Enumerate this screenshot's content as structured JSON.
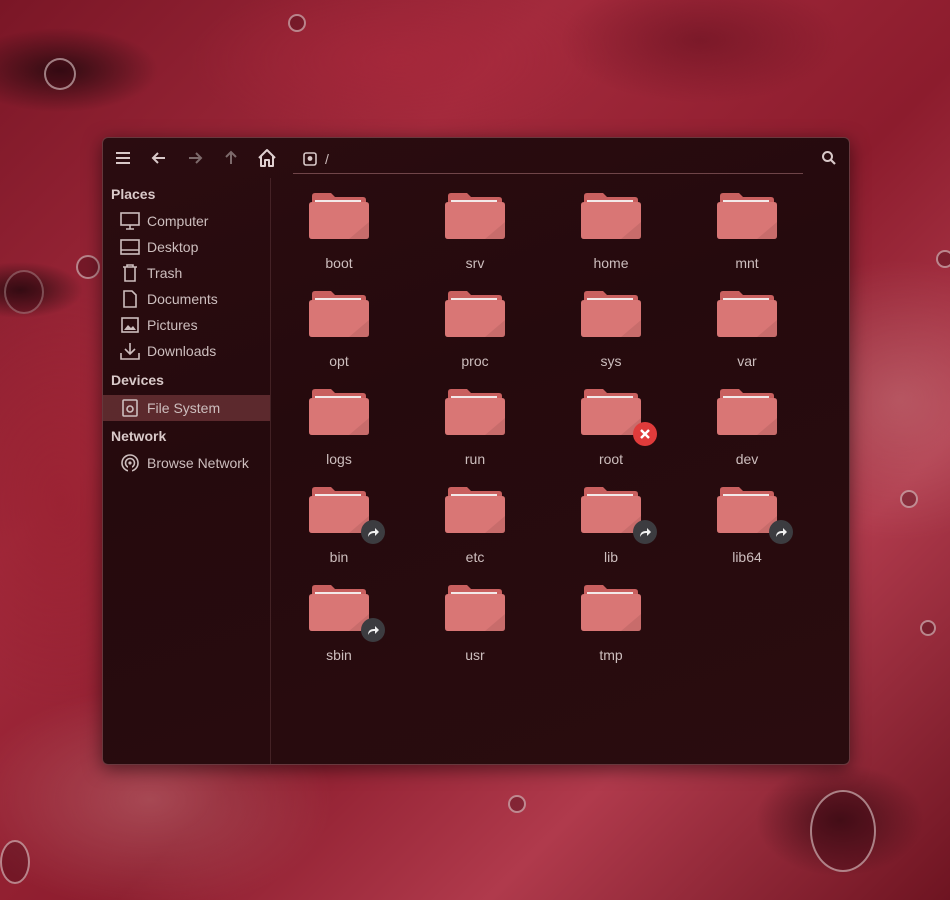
{
  "window": {
    "path": "/",
    "toolbar": {
      "menu_icon": "hamburger-menu-icon",
      "back_icon": "arrow-left-icon",
      "forward_icon": "arrow-right-icon",
      "up_icon": "arrow-up-icon",
      "home_icon": "home-icon",
      "search_icon": "search-icon"
    }
  },
  "sidebar": {
    "places_title": "Places",
    "places": [
      {
        "label": "Computer",
        "icon": "computer-icon"
      },
      {
        "label": "Desktop",
        "icon": "desktop-icon"
      },
      {
        "label": "Trash",
        "icon": "trash-icon"
      },
      {
        "label": "Documents",
        "icon": "document-icon"
      },
      {
        "label": "Pictures",
        "icon": "picture-icon"
      },
      {
        "label": "Downloads",
        "icon": "download-icon"
      }
    ],
    "devices_title": "Devices",
    "devices": [
      {
        "label": "File System",
        "icon": "drive-icon",
        "active": true
      }
    ],
    "network_title": "Network",
    "network": [
      {
        "label": "Browse Network",
        "icon": "network-icon"
      }
    ]
  },
  "folders": [
    {
      "name": "boot",
      "emblem": null
    },
    {
      "name": "srv",
      "emblem": null
    },
    {
      "name": "home",
      "emblem": null
    },
    {
      "name": "mnt",
      "emblem": null
    },
    {
      "name": "opt",
      "emblem": null
    },
    {
      "name": "proc",
      "emblem": null
    },
    {
      "name": "sys",
      "emblem": null
    },
    {
      "name": "var",
      "emblem": null
    },
    {
      "name": "logs",
      "emblem": null
    },
    {
      "name": "run",
      "emblem": null
    },
    {
      "name": "root",
      "emblem": "no-access"
    },
    {
      "name": "dev",
      "emblem": null
    },
    {
      "name": "bin",
      "emblem": "symlink"
    },
    {
      "name": "etc",
      "emblem": null
    },
    {
      "name": "lib",
      "emblem": "symlink"
    },
    {
      "name": "lib64",
      "emblem": "symlink"
    },
    {
      "name": "sbin",
      "emblem": "symlink"
    },
    {
      "name": "usr",
      "emblem": null
    },
    {
      "name": "tmp",
      "emblem": null
    }
  ],
  "colors": {
    "folder": "#d97675",
    "folder_tab": "#c9605f",
    "accent": "#a05055",
    "emblem_link": "#3c3c40",
    "emblem_noaccess": "#e03b3b"
  }
}
